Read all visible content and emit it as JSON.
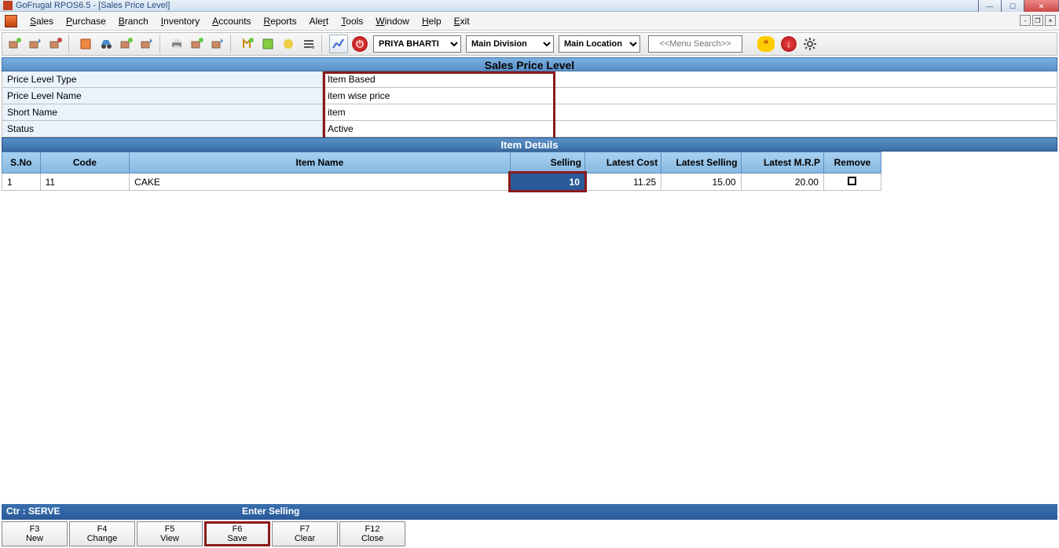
{
  "window": {
    "title": "GoFrugal RPOS6.5 - [Sales Price Level]"
  },
  "menu": [
    "Sales",
    "Purchase",
    "Branch",
    "Inventory",
    "Accounts",
    "Reports",
    "Alert",
    "Tools",
    "Window",
    "Help",
    "Exit"
  ],
  "toolbar": {
    "user": "PRIYA BHARTI",
    "division": "Main Division",
    "location": "Main Location",
    "search_placeholder": "<<Menu Search>>"
  },
  "section_title": "Sales Price Level",
  "fields": [
    {
      "label": "Price Level Type",
      "value": "Item Based"
    },
    {
      "label": "Price Level Name",
      "value": "item wise price"
    },
    {
      "label": "Short Name",
      "value": "item"
    },
    {
      "label": "Status",
      "value": "Active"
    }
  ],
  "item_header": "Item Details",
  "columns": {
    "sno": "S.No",
    "code": "Code",
    "name": "Item Name",
    "sell": "Selling",
    "lc": "Latest Cost",
    "ls": "Latest Selling",
    "mrp": "Latest M.R.P",
    "rm": "Remove"
  },
  "rows": [
    {
      "sno": "1",
      "code": "11",
      "name": "CAKE",
      "sell": "10",
      "lc": "11.25",
      "ls": "15.00",
      "mrp": "20.00"
    }
  ],
  "status": {
    "left": "Ctr : SERVE",
    "right": "Enter Selling"
  },
  "fkeys": [
    {
      "k": "F3",
      "t": "New"
    },
    {
      "k": "F4",
      "t": "Change"
    },
    {
      "k": "F5",
      "t": "View"
    },
    {
      "k": "F6",
      "t": "Save",
      "hl": true
    },
    {
      "k": "F7",
      "t": "Clear"
    },
    {
      "k": "F12",
      "t": "Close"
    }
  ]
}
